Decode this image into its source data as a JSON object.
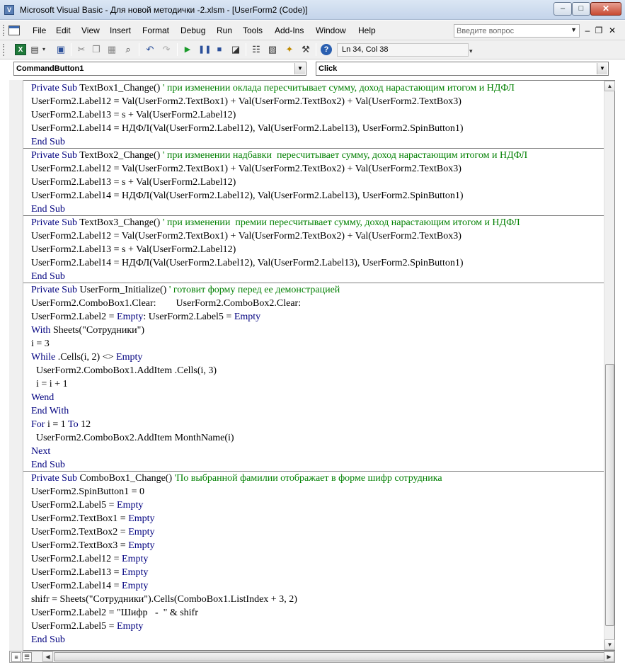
{
  "window": {
    "title": "Microsoft Visual Basic - Для новой методички -2.xlsm - [UserForm2 (Code)]",
    "min_label": "–",
    "max_label": "□",
    "close_label": "✕",
    "app_icon": "vba-app-icon"
  },
  "menubar": {
    "items": [
      {
        "label": "File"
      },
      {
        "label": "Edit"
      },
      {
        "label": "View"
      },
      {
        "label": "Insert"
      },
      {
        "label": "Format"
      },
      {
        "label": "Debug"
      },
      {
        "label": "Run"
      },
      {
        "label": "Tools"
      },
      {
        "label": "Add-Ins"
      },
      {
        "label": "Window"
      },
      {
        "label": "Help"
      }
    ],
    "help_placeholder": "Введите вопрос",
    "mdi_min": "–",
    "mdi_restore": "❐",
    "mdi_close": "✕"
  },
  "toolbar": {
    "icons": [
      "excel-icon",
      "insert-userform-icon",
      "save-icon",
      "cut-icon",
      "copy-icon",
      "paste-icon",
      "find-icon",
      "undo-icon",
      "redo-icon",
      "run-icon",
      "break-icon",
      "reset-icon",
      "design-mode-icon",
      "project-explorer-icon",
      "properties-icon",
      "object-browser-icon",
      "toolbox-icon",
      "help-icon"
    ],
    "status": "Ln 34, Col 38",
    "overflow": "▾"
  },
  "object_combo": {
    "value": "CommandButton1"
  },
  "procedure_combo": {
    "value": "Click"
  },
  "colors": {
    "keyword": "#00007f",
    "comment": "#007f00",
    "text": "#000000"
  },
  "code": {
    "lines": [
      [
        {
          "t": "kw",
          "v": "Private Sub"
        },
        {
          "t": "tx",
          "v": " TextBox1_Change() "
        },
        {
          "t": "cm",
          "v": "' при изменении оклада пересчитывает сумму, доход нарастающим итогом и НДФЛ"
        }
      ],
      [
        {
          "t": "tx",
          "v": "UserForm2.Label12 = Val(UserForm2.TextBox1) + Val(UserForm2.TextBox2) + Val(UserForm2.TextBox3)"
        }
      ],
      [
        {
          "t": "tx",
          "v": "UserForm2.Label13 = s + Val(UserForm2.Label12)"
        }
      ],
      [
        {
          "t": "tx",
          "v": "UserForm2.Label14 = НДФЛ(Val(UserForm2.Label12), Val(UserForm2.Label13), UserForm2.SpinButton1)"
        }
      ],
      [
        {
          "t": "kw",
          "v": "End Sub"
        }
      ],
      [
        {
          "t": "kw",
          "v": "Private Sub"
        },
        {
          "t": "tx",
          "v": " TextBox2_Change() "
        },
        {
          "t": "cm",
          "v": "' при изменении надбавки  пересчитывает сумму, доход нарастающим итогом и НДФЛ"
        }
      ],
      [
        {
          "t": "tx",
          "v": "UserForm2.Label12 = Val(UserForm2.TextBox1) + Val(UserForm2.TextBox2) + Val(UserForm2.TextBox3)"
        }
      ],
      [
        {
          "t": "tx",
          "v": "UserForm2.Label13 = s + Val(UserForm2.Label12)"
        }
      ],
      [
        {
          "t": "tx",
          "v": "UserForm2.Label14 = НДФЛ(Val(UserForm2.Label12), Val(UserForm2.Label13), UserForm2.SpinButton1)"
        }
      ],
      [
        {
          "t": "kw",
          "v": "End Sub"
        }
      ],
      [
        {
          "t": "kw",
          "v": "Private Sub"
        },
        {
          "t": "tx",
          "v": " TextBox3_Change() "
        },
        {
          "t": "cm",
          "v": "' при изменении  премии пересчитывает сумму, доход нарастающим итогом и НДФЛ"
        }
      ],
      [
        {
          "t": "tx",
          "v": "UserForm2.Label12 = Val(UserForm2.TextBox1) + Val(UserForm2.TextBox2) + Val(UserForm2.TextBox3)"
        }
      ],
      [
        {
          "t": "tx",
          "v": "UserForm2.Label13 = s + Val(UserForm2.Label12)"
        }
      ],
      [
        {
          "t": "tx",
          "v": "UserForm2.Label14 = НДФЛ(Val(UserForm2.Label12), Val(UserForm2.Label13), UserForm2.SpinButton1)"
        }
      ],
      [
        {
          "t": "kw",
          "v": "End Sub"
        }
      ],
      [
        {
          "t": "kw",
          "v": "Private Sub"
        },
        {
          "t": "tx",
          "v": " UserForm_Initialize() "
        },
        {
          "t": "cm",
          "v": "' готовит форму перед ее демонстрацией"
        }
      ],
      [
        {
          "t": "tx",
          "v": "UserForm2.ComboBox1.Clear:        UserForm2.ComboBox2.Clear:"
        }
      ],
      [
        {
          "t": "tx",
          "v": "UserForm2.Label2 = "
        },
        {
          "t": "kw",
          "v": "Empty"
        },
        {
          "t": "tx",
          "v": ": UserForm2.Label5 = "
        },
        {
          "t": "kw",
          "v": "Empty"
        }
      ],
      [
        {
          "t": "kw",
          "v": "With"
        },
        {
          "t": "tx",
          "v": " Sheets(\"Сотрудники\")"
        }
      ],
      [
        {
          "t": "tx",
          "v": "i = 3"
        }
      ],
      [
        {
          "t": "kw",
          "v": "While"
        },
        {
          "t": "tx",
          "v": " .Cells(i, 2) <> "
        },
        {
          "t": "kw",
          "v": "Empty"
        }
      ],
      [
        {
          "t": "tx",
          "v": "  UserForm2.ComboBox1.AddItem .Cells(i, 3)"
        }
      ],
      [
        {
          "t": "tx",
          "v": "  i = i + 1"
        }
      ],
      [
        {
          "t": "kw",
          "v": "Wend"
        }
      ],
      [
        {
          "t": "kw",
          "v": "End With"
        }
      ],
      [
        {
          "t": "kw",
          "v": "For"
        },
        {
          "t": "tx",
          "v": " i = 1 "
        },
        {
          "t": "kw",
          "v": "To"
        },
        {
          "t": "tx",
          "v": " 12"
        }
      ],
      [
        {
          "t": "tx",
          "v": "  UserForm2.ComboBox2.AddItem MonthName(i)"
        }
      ],
      [
        {
          "t": "kw",
          "v": "Next"
        }
      ],
      [
        {
          "t": "kw",
          "v": "End Sub"
        }
      ],
      [
        {
          "t": "kw",
          "v": "Private Sub"
        },
        {
          "t": "tx",
          "v": " ComboBox1_Change() "
        },
        {
          "t": "cm",
          "v": "'По выбранной фамилии отображает в форме шифр сотрудника"
        }
      ],
      [
        {
          "t": "tx",
          "v": "UserForm2.SpinButton1 = 0"
        }
      ],
      [
        {
          "t": "tx",
          "v": "UserForm2.Label5 = "
        },
        {
          "t": "kw",
          "v": "Empty"
        }
      ],
      [
        {
          "t": "tx",
          "v": "UserForm2.TextBox1 = "
        },
        {
          "t": "kw",
          "v": "Empty"
        }
      ],
      [
        {
          "t": "tx",
          "v": "UserForm2.TextBox2 = "
        },
        {
          "t": "kw",
          "v": "Empty"
        }
      ],
      [
        {
          "t": "tx",
          "v": "UserForm2.TextBox3 = "
        },
        {
          "t": "kw",
          "v": "Empty"
        }
      ],
      [
        {
          "t": "tx",
          "v": "UserForm2.Label12 = "
        },
        {
          "t": "kw",
          "v": "Empty"
        }
      ],
      [
        {
          "t": "tx",
          "v": "UserForm2.Label13 = "
        },
        {
          "t": "kw",
          "v": "Empty"
        }
      ],
      [
        {
          "t": "tx",
          "v": "UserForm2.Label14 = "
        },
        {
          "t": "kw",
          "v": "Empty"
        }
      ],
      [
        {
          "t": "tx",
          "v": "shifr = Sheets(\"Сотрудники\").Cells(ComboBox1.ListIndex + 3, 2)"
        }
      ],
      [
        {
          "t": "tx",
          "v": "UserForm2.Label2 = \"Шифр   -  \" & shifr"
        }
      ],
      [
        {
          "t": "tx",
          "v": "UserForm2.Label5 = "
        },
        {
          "t": "kw",
          "v": "Empty"
        }
      ],
      [
        {
          "t": "kw",
          "v": "End Sub"
        }
      ]
    ]
  },
  "scrollbar": {
    "up": "▲",
    "down": "▼",
    "left": "◀",
    "right": "▶"
  }
}
